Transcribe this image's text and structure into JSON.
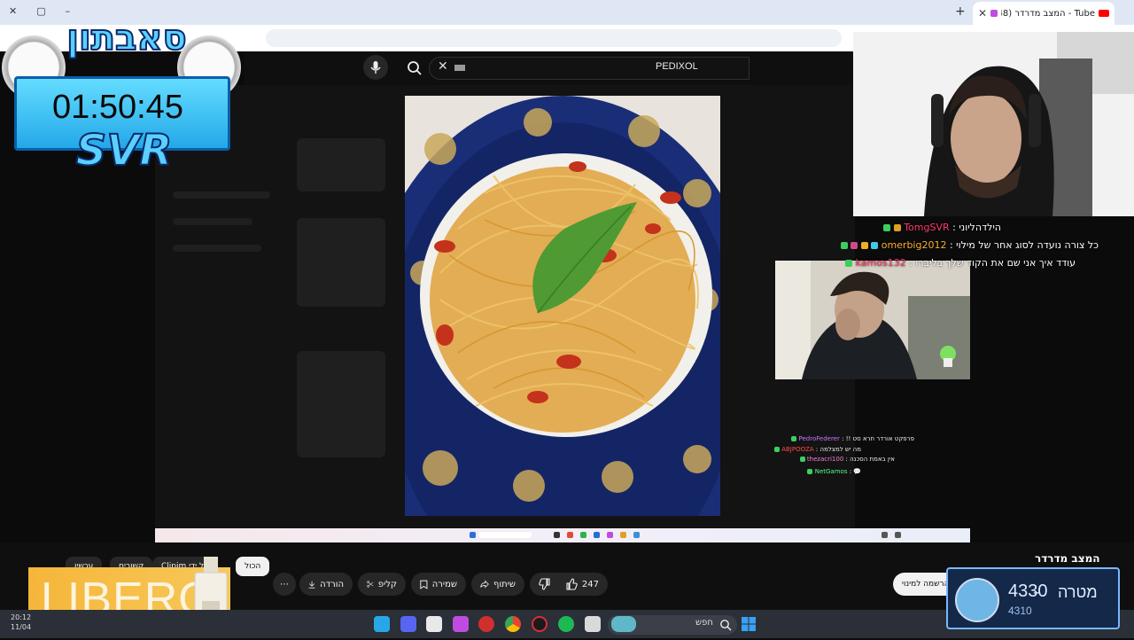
{
  "browser": {
    "tab_title": "Tube - המצב מדרדר (248)",
    "window_controls": [
      "✕",
      "▢",
      "–"
    ]
  },
  "youtube": {
    "search_value": "PEDIXOL",
    "channel_title": "המצב מדרדר",
    "like_count": "247",
    "actions": {
      "share": "שיתוף",
      "save": "שמירה",
      "clip": "קליפ",
      "download": "הורדה",
      "more": "⋯"
    },
    "chips": {
      "all": "הכול",
      "clipim": "Clipim על ידי",
      "related": "קשורים",
      "for_sale": "עכשיו"
    },
    "subscribe": "הרשמה למינוי"
  },
  "overlay": {
    "title": "סאבתון",
    "timer": "01:50:45",
    "timer_label": "SVR"
  },
  "chat": [
    {
      "user": "TomgSVR",
      "message": "הילדהליוני :",
      "user_color": "#ff3a6b"
    },
    {
      "user": "omerbig2012",
      "message": "כל צורה נועדה לסוג אחר של מילוי :",
      "user_color": "#ffae2b"
    },
    {
      "user": "kamos132",
      "message": "עודד איך אני שם את הקוד שלך בליברו :",
      "user_color": "#ff3a6b"
    }
  ],
  "chat_small": [
    {
      "user": "PedroFederer",
      "message": "פרפקט אורדר חרא סט !!",
      "user_color": "#c57bff"
    },
    {
      "user": "ABJPOOZA",
      "message": "מה יש למצלמה",
      "user_color": "#ff4a4a"
    },
    {
      "user": "thezacri100",
      "message": "אין באמת הסכנה",
      "user_color": "#ff7ad9"
    },
    {
      "user": "NetGamos",
      "message": "💬",
      "user_color": "#55ff88"
    }
  ],
  "goal": {
    "label": "מטרה",
    "dash": "–",
    "value": "4330",
    "current": "4310"
  },
  "ad": {
    "brand": "LIBERO"
  },
  "taskbar": {
    "search_placeholder": "חפש",
    "time": "20:12",
    "date": "11/04"
  }
}
